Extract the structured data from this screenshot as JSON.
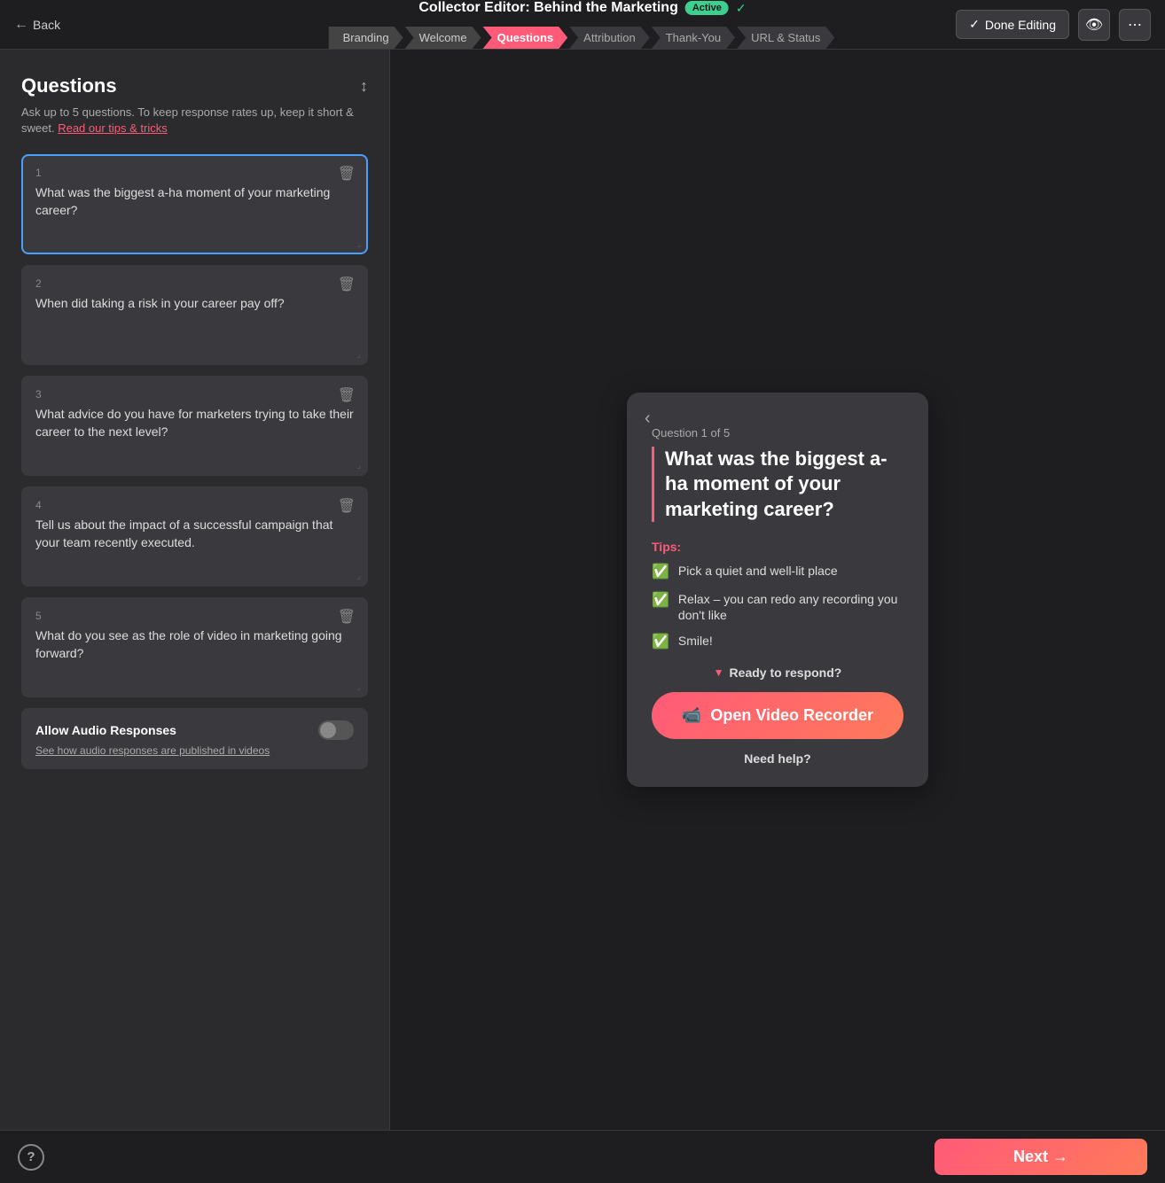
{
  "topbar": {
    "back_label": "Back",
    "title": "Collector Editor: Behind the Marketing",
    "active_badge": "Active",
    "done_editing_label": "Done Editing",
    "nav_tabs": [
      {
        "id": "branding",
        "label": "Branding",
        "state": "done"
      },
      {
        "id": "welcome",
        "label": "Welcome",
        "state": "done"
      },
      {
        "id": "questions",
        "label": "Questions",
        "state": "active"
      },
      {
        "id": "attribution",
        "label": "Attribution",
        "state": "upcoming"
      },
      {
        "id": "thank-you",
        "label": "Thank-You",
        "state": "upcoming"
      },
      {
        "id": "url-status",
        "label": "URL & Status",
        "state": "upcoming"
      }
    ]
  },
  "left_panel": {
    "title": "Questions",
    "subtitle": "Ask up to 5 questions. To keep response rates up, keep it short & sweet.",
    "tips_link": "Read our tips & tricks",
    "questions": [
      {
        "number": "1",
        "text": "What was the biggest a-ha moment of your marketing career?",
        "selected": true
      },
      {
        "number": "2",
        "text": "When did taking a risk in your career pay off?",
        "selected": false
      },
      {
        "number": "3",
        "text": "What advice do you have for marketers trying to take their career to the next level?",
        "selected": false
      },
      {
        "number": "4",
        "text": "Tell us about the impact of a successful campaign that your team recently executed.",
        "selected": false
      },
      {
        "number": "5",
        "text": "What do you see as the role of video in marketing going forward?",
        "selected": false
      }
    ],
    "audio_responses": {
      "label": "Allow Audio Responses",
      "subtitle_prefix": "See how ",
      "subtitle_link": "audio responses",
      "subtitle_suffix": " are published in videos"
    }
  },
  "preview": {
    "q_counter": "Question 1 of 5",
    "q_text": "What was the biggest a-ha moment of your marketing career?",
    "tips_label": "Tips:",
    "tips": [
      "Pick a quiet and well-lit place",
      "Relax – you can redo any recording you don't like",
      "Smile!"
    ],
    "ready_text": "Ready to respond?",
    "recorder_btn": "Open Video Recorder",
    "need_help": "Need help?"
  },
  "bottom": {
    "next_label": "Next →",
    "help_label": "?"
  }
}
